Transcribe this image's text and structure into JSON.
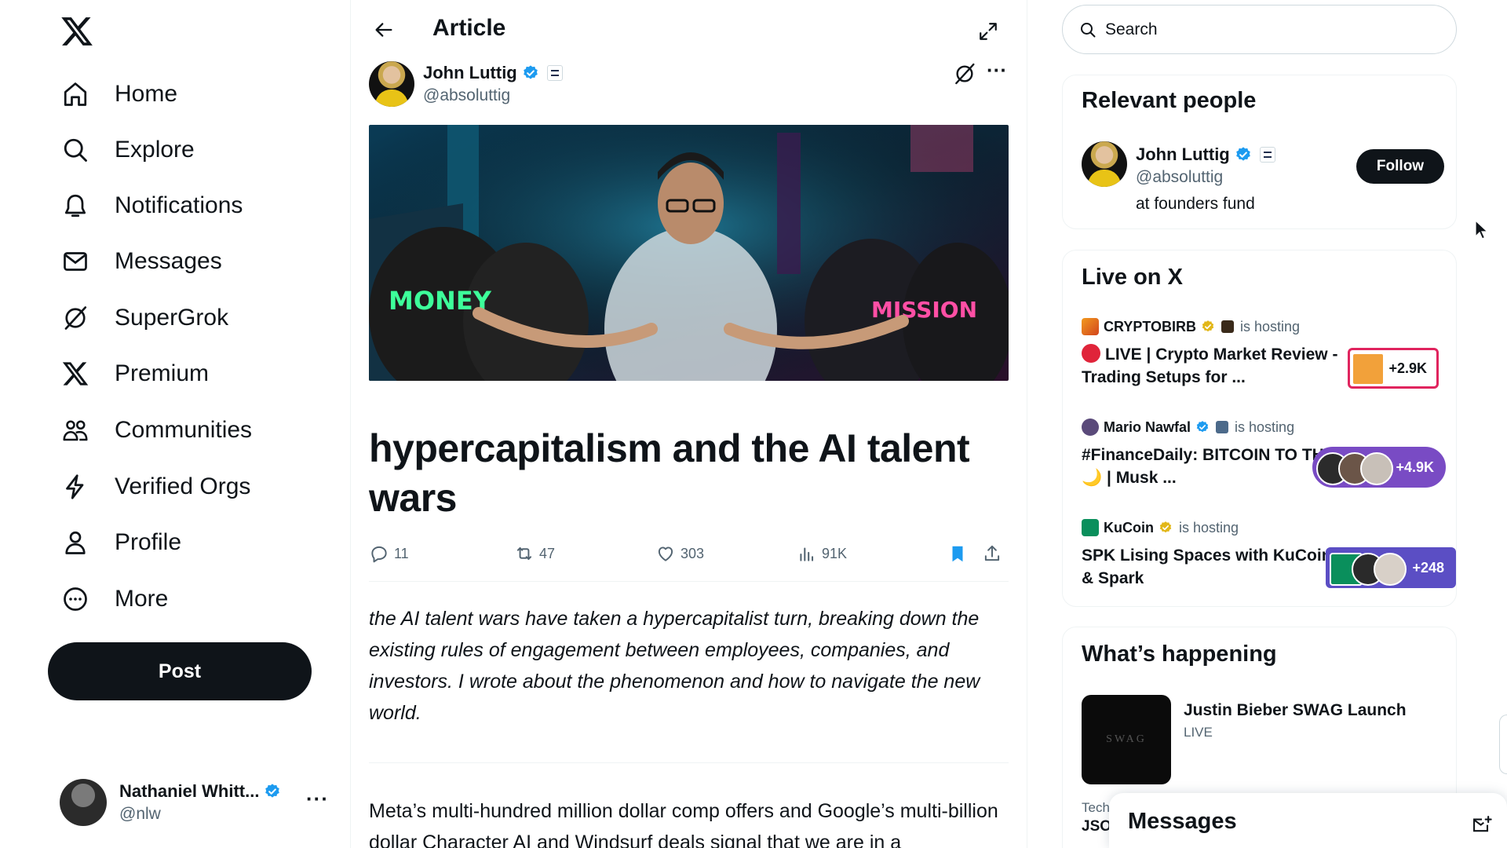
{
  "nav": {
    "items": [
      {
        "label": "Home",
        "icon": "home-icon"
      },
      {
        "label": "Explore",
        "icon": "search-icon"
      },
      {
        "label": "Notifications",
        "icon": "bell-icon"
      },
      {
        "label": "Messages",
        "icon": "envelope-icon"
      },
      {
        "label": "SuperGrok",
        "icon": "grok-icon"
      },
      {
        "label": "Premium",
        "icon": "x-icon"
      },
      {
        "label": "Communities",
        "icon": "people-icon"
      },
      {
        "label": "Verified Orgs",
        "icon": "lightning-icon"
      },
      {
        "label": "Profile",
        "icon": "person-icon"
      },
      {
        "label": "More",
        "icon": "more-circle-icon"
      }
    ],
    "post_label": "Post"
  },
  "account": {
    "name": "Nathaniel Whitt...",
    "handle": "@nlw",
    "more": "···"
  },
  "header": {
    "title": "Article"
  },
  "article": {
    "author_name": "John Luttig",
    "author_handle": "@absoluttig",
    "more": "···",
    "hero_text_left": "MONEY",
    "hero_text_right": "MISSION",
    "title": "hypercapitalism and the AI talent wars",
    "stats": {
      "replies": "11",
      "reposts": "47",
      "likes": "303",
      "views": "91K"
    },
    "summary": "the AI talent wars have taken a hypercapitalist turn, breaking down the existing rules of engagement between employees, companies, and investors. I wrote about the phenomenon and how to navigate the new world.",
    "body": "Meta’s multi-hundred million dollar comp offers and Google’s multi-billion dollar Character AI and Windsurf deals signal that we are in a"
  },
  "search": {
    "placeholder": "Search"
  },
  "relevant_people": {
    "title": "Relevant people",
    "name": "John Luttig",
    "handle": "@absoluttig",
    "bio": "at founders fund",
    "follow_label": "Follow"
  },
  "live": {
    "title": "Live on X",
    "items": [
      {
        "host": "CRYPTOBIRB",
        "hosting": "is hosting",
        "title": "LIVE | Crypto Market Review - Trading Setups for ...",
        "count": "+2.9K"
      },
      {
        "host": "Mario Nawfal",
        "hosting": "is hosting",
        "title": "#FinanceDaily: BITCOIN TO THE 🌙 | Musk ...",
        "count": "+4.9K"
      },
      {
        "host": "KuCoin",
        "hosting": "is hosting",
        "title": "SPK Lising Spaces with KuCoin & Spark",
        "count": "+248"
      }
    ]
  },
  "happening": {
    "title": "What’s happening",
    "trend_image_text": "SWAG",
    "trend_title": "Justin Bieber SWAG Launch",
    "trend_sub": "LIVE",
    "next_category": "Tech",
    "next_title": "JSO"
  },
  "messages_drawer": {
    "title": "Messages"
  },
  "colors": {
    "text": "#0f1419",
    "muted": "#536471",
    "verified": "#1d9bf0",
    "gold": "#e2b719",
    "bookmark": "#1d9bf0"
  }
}
